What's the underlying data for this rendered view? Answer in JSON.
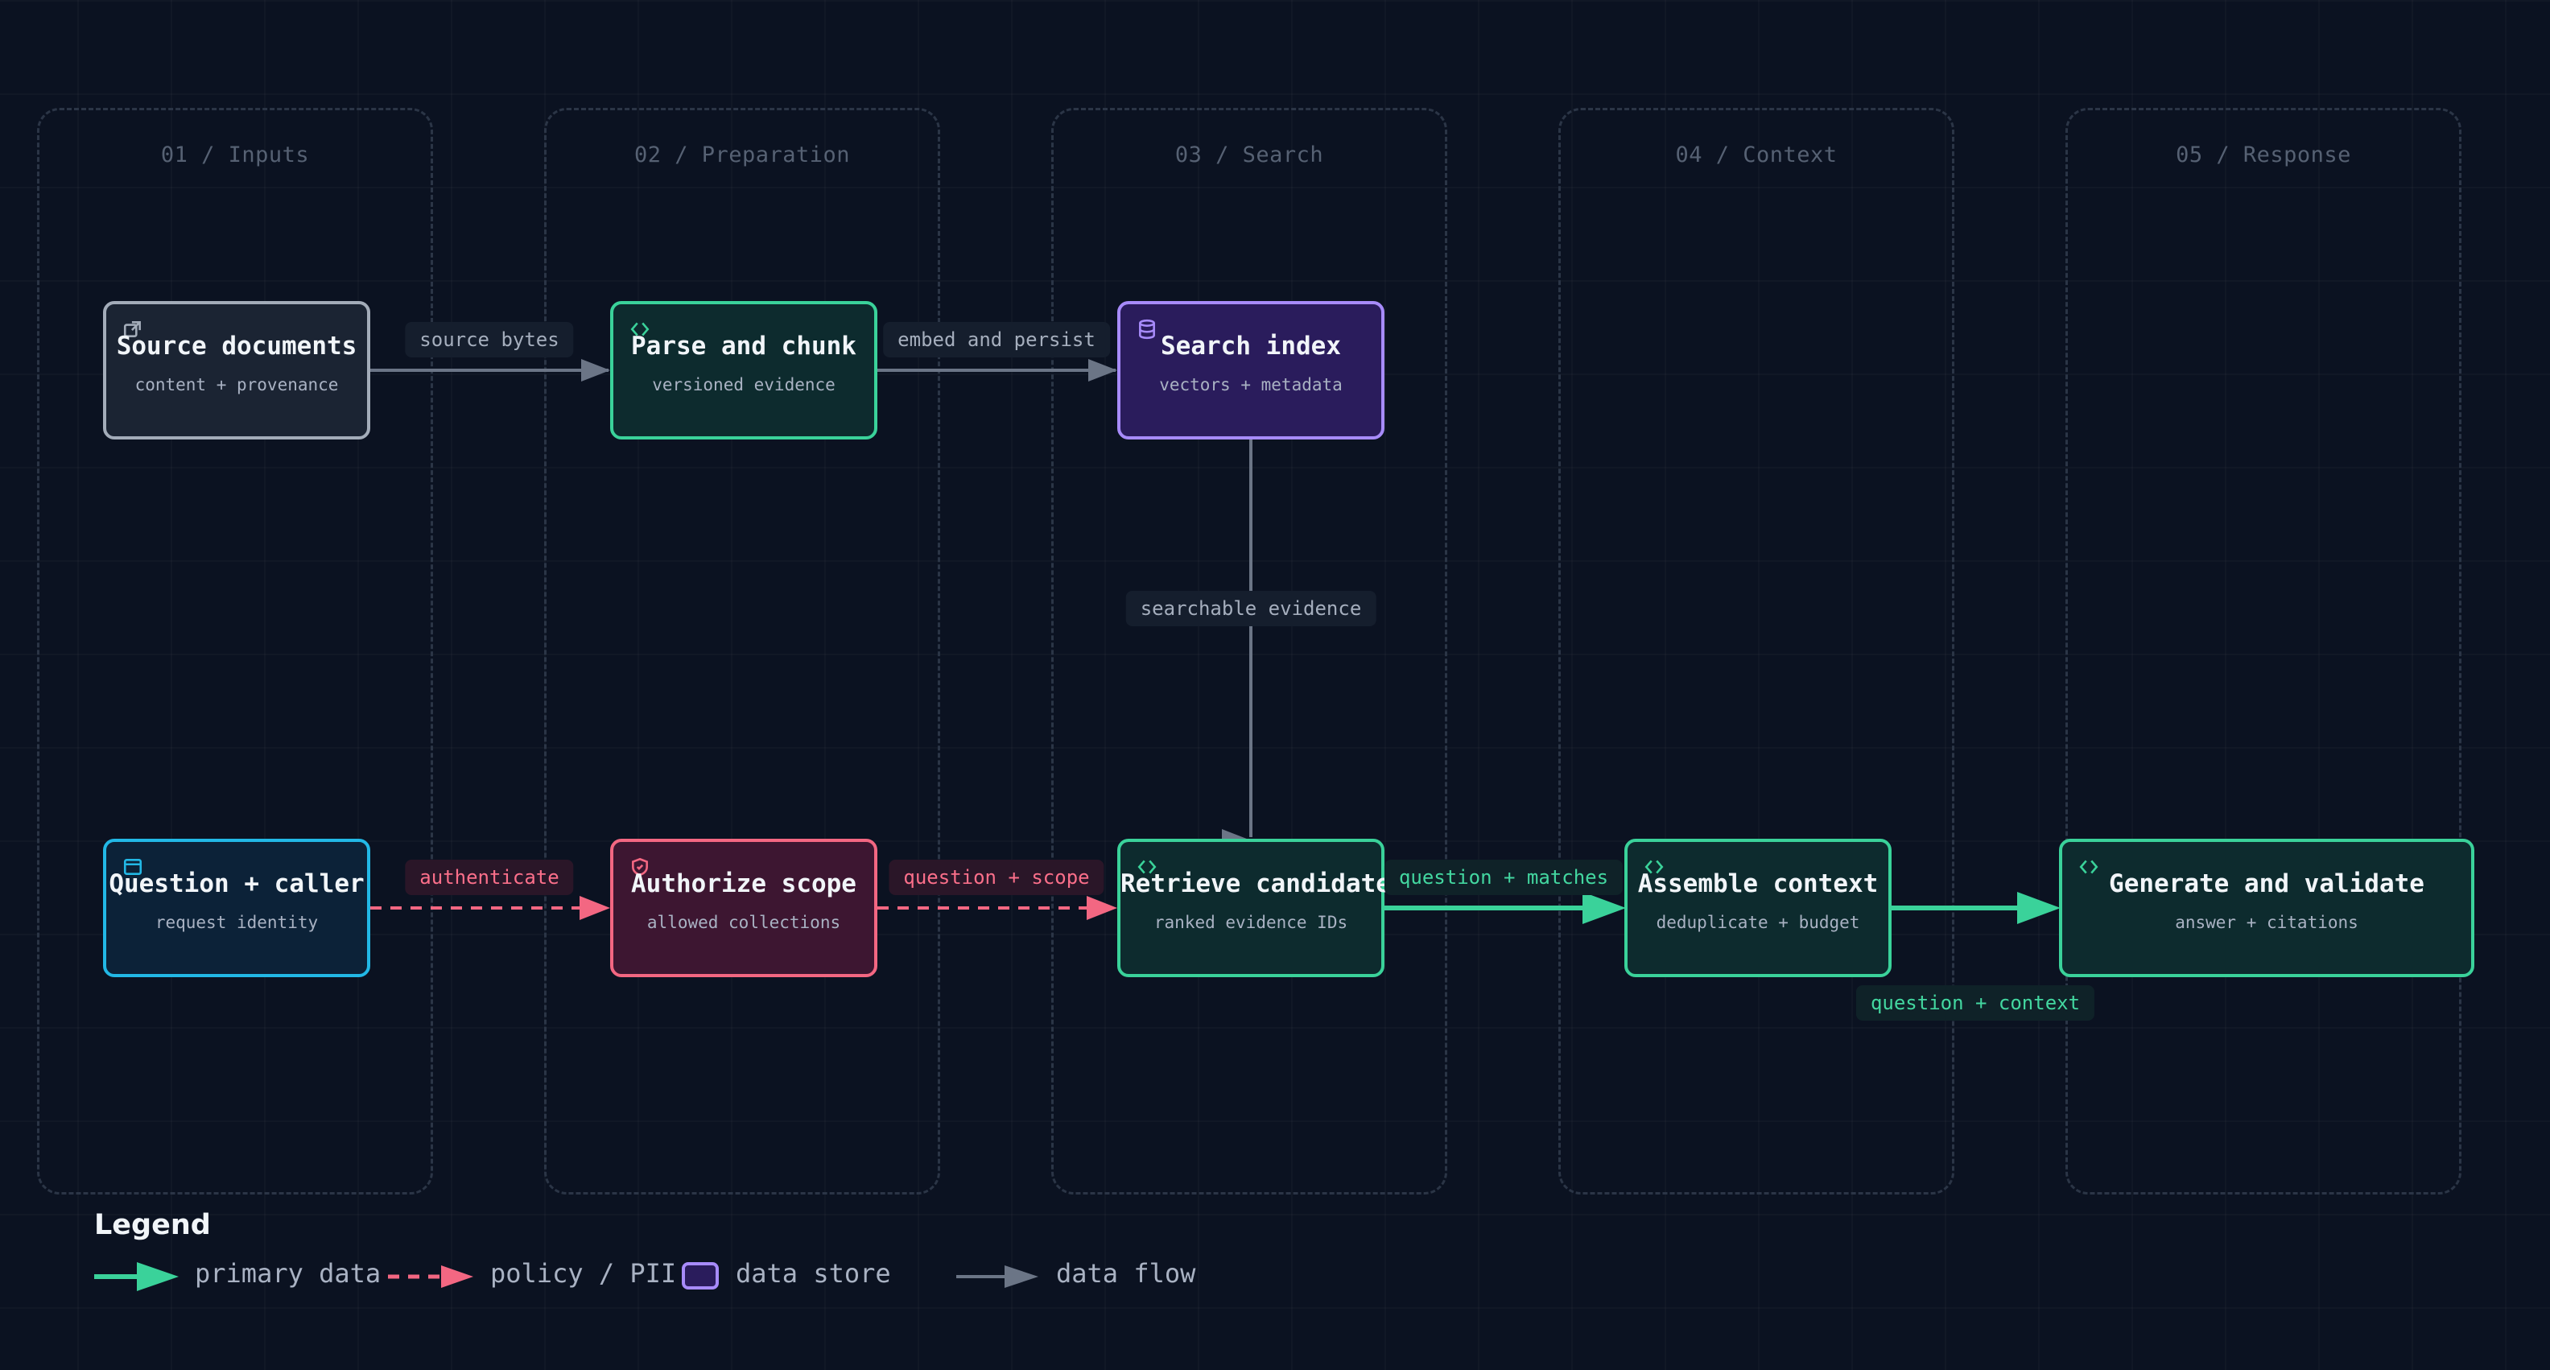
{
  "lanes": [
    {
      "title": "01 / Inputs"
    },
    {
      "title": "02 / Preparation"
    },
    {
      "title": "03 / Search"
    },
    {
      "title": "04 / Context"
    },
    {
      "title": "05 / Response"
    }
  ],
  "nodes": {
    "source_documents": {
      "title": "Source documents",
      "subtitle": "content + provenance",
      "icon": "external-link-icon"
    },
    "parse_and_chunk": {
      "title": "Parse and chunk",
      "subtitle": "versioned evidence",
      "icon": "code-icon"
    },
    "search_index": {
      "title": "Search index",
      "subtitle": "vectors + metadata",
      "icon": "database-icon"
    },
    "question_caller": {
      "title": "Question + caller",
      "subtitle": "request identity",
      "icon": "browser-window-icon"
    },
    "authorize_scope": {
      "title": "Authorize scope",
      "subtitle": "allowed collections",
      "icon": "shield-icon"
    },
    "retrieve_candidates": {
      "title": "Retrieve candidates",
      "subtitle": "ranked evidence IDs",
      "icon": "code-icon"
    },
    "assemble_context": {
      "title": "Assemble context",
      "subtitle": "deduplicate + budget",
      "icon": "code-icon"
    },
    "generate_validate": {
      "title": "Generate and validate",
      "subtitle": "answer + citations",
      "icon": "code-icon"
    }
  },
  "edges": {
    "source_bytes": "source bytes",
    "embed_and_persist": "embed and persist",
    "searchable_evidence": "searchable evidence",
    "authenticate": "authenticate",
    "question_scope": "question + scope",
    "question_matches": "question + matches",
    "question_context": "question + context"
  },
  "legend": {
    "title": "Legend",
    "primary": "primary data",
    "policy": "policy / PII",
    "store": "data store",
    "flow": "data flow"
  },
  "colors": {
    "background": "#0b1221",
    "primary_green": "#3ad29a",
    "policy_pink": "#f36782",
    "store_purple": "#a78bfa",
    "flow_gray": "#6b7586",
    "input_blue": "#22b8e6",
    "neutral_border": "#a3acb9"
  }
}
